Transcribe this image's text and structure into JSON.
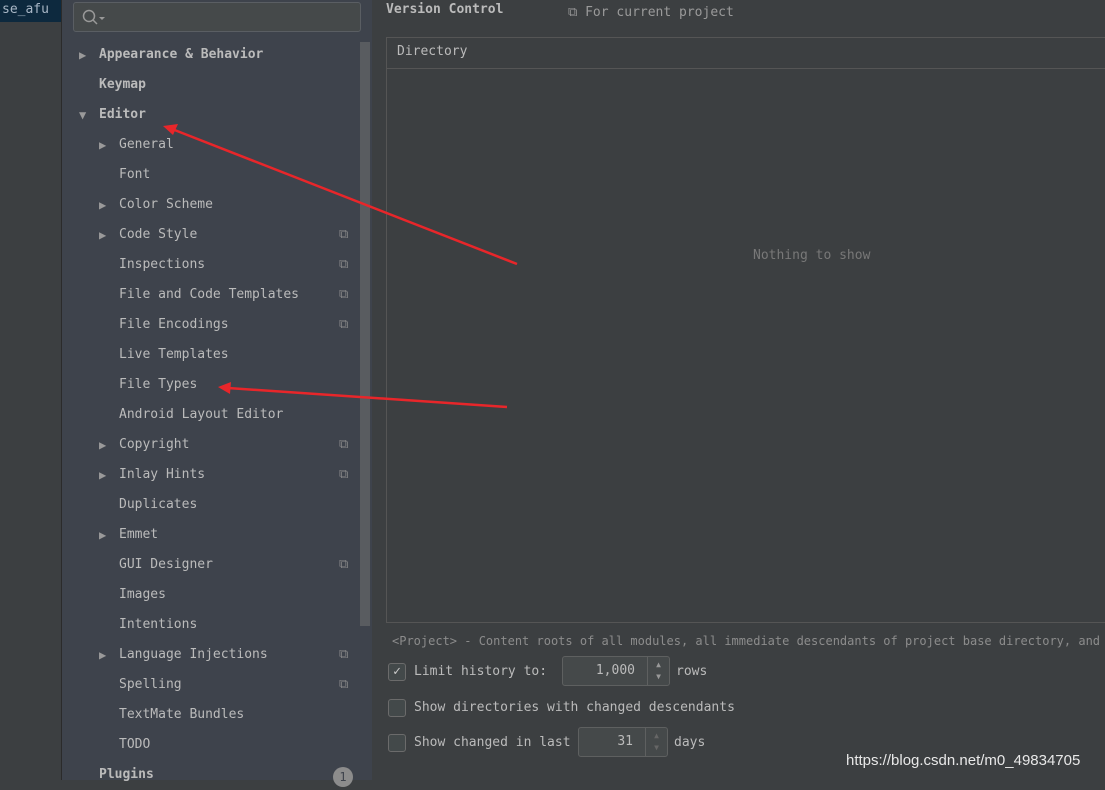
{
  "left_tab": "se_afu",
  "search": {
    "placeholder": ""
  },
  "tree": [
    {
      "label": "Appearance & Behavior",
      "level": 0,
      "arrow": "▶",
      "bold": true,
      "copy": false
    },
    {
      "label": "Keymap",
      "level": 0,
      "arrow": "",
      "bold": true,
      "copy": false
    },
    {
      "label": "Editor",
      "level": 0,
      "arrow": "▼",
      "bold": true,
      "copy": false
    },
    {
      "label": "General",
      "level": 1,
      "arrow": "▶",
      "copy": false
    },
    {
      "label": "Font",
      "level": 1,
      "arrow": "",
      "copy": false
    },
    {
      "label": "Color Scheme",
      "level": 1,
      "arrow": "▶",
      "copy": false
    },
    {
      "label": "Code Style",
      "level": 1,
      "arrow": "▶",
      "copy": true
    },
    {
      "label": "Inspections",
      "level": 1,
      "arrow": "",
      "copy": true
    },
    {
      "label": "File and Code Templates",
      "level": 1,
      "arrow": "",
      "copy": true
    },
    {
      "label": "File Encodings",
      "level": 1,
      "arrow": "",
      "copy": true
    },
    {
      "label": "Live Templates",
      "level": 1,
      "arrow": "",
      "copy": false
    },
    {
      "label": "File Types",
      "level": 1,
      "arrow": "",
      "copy": false
    },
    {
      "label": "Android Layout Editor",
      "level": 1,
      "arrow": "",
      "copy": false
    },
    {
      "label": "Copyright",
      "level": 1,
      "arrow": "▶",
      "copy": true
    },
    {
      "label": "Inlay Hints",
      "level": 1,
      "arrow": "▶",
      "copy": true
    },
    {
      "label": "Duplicates",
      "level": 1,
      "arrow": "",
      "copy": false
    },
    {
      "label": "Emmet",
      "level": 1,
      "arrow": "▶",
      "copy": false
    },
    {
      "label": "GUI Designer",
      "level": 1,
      "arrow": "",
      "copy": true
    },
    {
      "label": "Images",
      "level": 1,
      "arrow": "",
      "copy": false
    },
    {
      "label": "Intentions",
      "level": 1,
      "arrow": "",
      "copy": false
    },
    {
      "label": "Language Injections",
      "level": 1,
      "arrow": "▶",
      "copy": true
    },
    {
      "label": "Spelling",
      "level": 1,
      "arrow": "",
      "copy": true
    },
    {
      "label": "TextMate Bundles",
      "level": 1,
      "arrow": "",
      "copy": false
    },
    {
      "label": "TODO",
      "level": 1,
      "arrow": "",
      "copy": false
    },
    {
      "label": "Plugins",
      "level": 0,
      "arrow": "",
      "bold": true,
      "copy": false
    }
  ],
  "plugins_badge": "1",
  "main": {
    "title": "Version Control",
    "scope": "For current project",
    "column": "Directory",
    "empty": "Nothing to show",
    "hint": "<Project> - Content roots of all modules, all immediate descendants of project base directory, and .id",
    "limit_label": "Limit history to:",
    "limit_checked": true,
    "limit_value": "1,000",
    "limit_unit": "rows",
    "show_dirs_label": "Show directories with changed descendants",
    "show_dirs_checked": false,
    "changed_label": "Show changed in last",
    "changed_checked": false,
    "changed_value": "31",
    "changed_unit": "days"
  },
  "watermark": "https://blog.csdn.net/m0_49834705",
  "annotation_color": "#e8262a"
}
